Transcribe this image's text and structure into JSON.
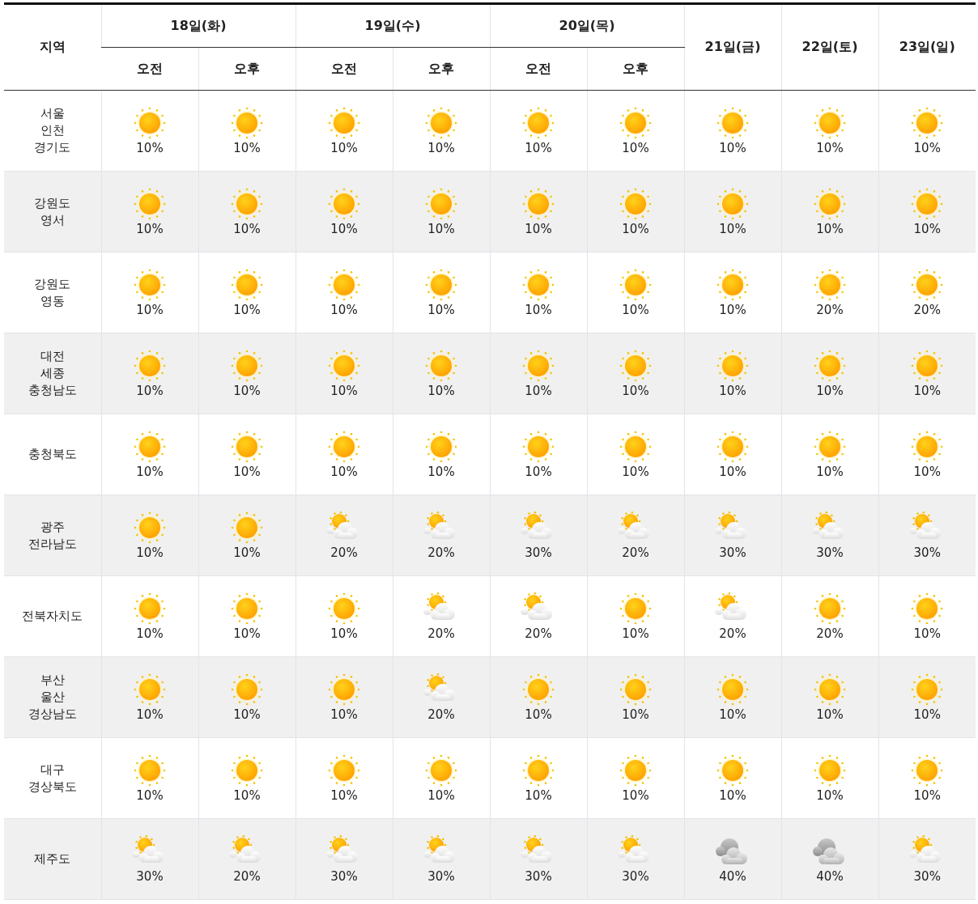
{
  "table": {
    "region_header": "지역",
    "days": [
      {
        "label": "18일(화)",
        "periods": [
          "오전",
          "오후"
        ]
      },
      {
        "label": "19일(수)",
        "periods": [
          "오전",
          "오후"
        ]
      },
      {
        "label": "20일(목)",
        "periods": [
          "오전",
          "오후"
        ]
      },
      {
        "label": "21일(금)"
      },
      {
        "label": "22일(토)"
      },
      {
        "label": "23일(일)"
      }
    ],
    "rows": [
      {
        "region": "서울\n인천\n경기도",
        "cells": [
          {
            "kind": "sunny",
            "pop": "10%"
          },
          {
            "kind": "sunny",
            "pop": "10%"
          },
          {
            "kind": "sunny",
            "pop": "10%"
          },
          {
            "kind": "sunny",
            "pop": "10%"
          },
          {
            "kind": "sunny",
            "pop": "10%"
          },
          {
            "kind": "sunny",
            "pop": "10%"
          },
          {
            "kind": "sunny",
            "pop": "10%"
          },
          {
            "kind": "sunny",
            "pop": "10%"
          },
          {
            "kind": "sunny",
            "pop": "10%"
          }
        ]
      },
      {
        "region": "강원도\n영서",
        "cells": [
          {
            "kind": "sunny",
            "pop": "10%"
          },
          {
            "kind": "sunny",
            "pop": "10%"
          },
          {
            "kind": "sunny",
            "pop": "10%"
          },
          {
            "kind": "sunny",
            "pop": "10%"
          },
          {
            "kind": "sunny",
            "pop": "10%"
          },
          {
            "kind": "sunny",
            "pop": "10%"
          },
          {
            "kind": "sunny",
            "pop": "10%"
          },
          {
            "kind": "sunny",
            "pop": "10%"
          },
          {
            "kind": "sunny",
            "pop": "10%"
          }
        ]
      },
      {
        "region": "강원도\n영동",
        "cells": [
          {
            "kind": "sunny",
            "pop": "10%"
          },
          {
            "kind": "sunny",
            "pop": "10%"
          },
          {
            "kind": "sunny",
            "pop": "10%"
          },
          {
            "kind": "sunny",
            "pop": "10%"
          },
          {
            "kind": "sunny",
            "pop": "10%"
          },
          {
            "kind": "sunny",
            "pop": "10%"
          },
          {
            "kind": "sunny",
            "pop": "10%"
          },
          {
            "kind": "sunny",
            "pop": "20%"
          },
          {
            "kind": "sunny",
            "pop": "20%"
          }
        ]
      },
      {
        "region": "대전\n세종\n충청남도",
        "cells": [
          {
            "kind": "sunny",
            "pop": "10%"
          },
          {
            "kind": "sunny",
            "pop": "10%"
          },
          {
            "kind": "sunny",
            "pop": "10%"
          },
          {
            "kind": "sunny",
            "pop": "10%"
          },
          {
            "kind": "sunny",
            "pop": "10%"
          },
          {
            "kind": "sunny",
            "pop": "10%"
          },
          {
            "kind": "sunny",
            "pop": "10%"
          },
          {
            "kind": "sunny",
            "pop": "10%"
          },
          {
            "kind": "sunny",
            "pop": "10%"
          }
        ]
      },
      {
        "region": "충청북도",
        "cells": [
          {
            "kind": "sunny",
            "pop": "10%"
          },
          {
            "kind": "sunny",
            "pop": "10%"
          },
          {
            "kind": "sunny",
            "pop": "10%"
          },
          {
            "kind": "sunny",
            "pop": "10%"
          },
          {
            "kind": "sunny",
            "pop": "10%"
          },
          {
            "kind": "sunny",
            "pop": "10%"
          },
          {
            "kind": "sunny",
            "pop": "10%"
          },
          {
            "kind": "sunny",
            "pop": "10%"
          },
          {
            "kind": "sunny",
            "pop": "10%"
          }
        ]
      },
      {
        "region": "광주\n전라남도",
        "cells": [
          {
            "kind": "sunny",
            "pop": "10%"
          },
          {
            "kind": "sunny",
            "pop": "10%"
          },
          {
            "kind": "partly_cloudy",
            "pop": "20%"
          },
          {
            "kind": "partly_cloudy",
            "pop": "20%"
          },
          {
            "kind": "partly_cloudy",
            "pop": "30%"
          },
          {
            "kind": "partly_cloudy",
            "pop": "20%"
          },
          {
            "kind": "partly_cloudy",
            "pop": "30%"
          },
          {
            "kind": "partly_cloudy",
            "pop": "30%"
          },
          {
            "kind": "partly_cloudy",
            "pop": "30%"
          }
        ]
      },
      {
        "region": "전북자치도",
        "cells": [
          {
            "kind": "sunny",
            "pop": "10%"
          },
          {
            "kind": "sunny",
            "pop": "10%"
          },
          {
            "kind": "sunny",
            "pop": "10%"
          },
          {
            "kind": "partly_cloudy",
            "pop": "20%"
          },
          {
            "kind": "partly_cloudy",
            "pop": "20%"
          },
          {
            "kind": "sunny",
            "pop": "10%"
          },
          {
            "kind": "partly_cloudy",
            "pop": "20%"
          },
          {
            "kind": "sunny",
            "pop": "20%"
          },
          {
            "kind": "sunny",
            "pop": "10%"
          }
        ]
      },
      {
        "region": "부산\n울산\n경상남도",
        "cells": [
          {
            "kind": "sunny",
            "pop": "10%"
          },
          {
            "kind": "sunny",
            "pop": "10%"
          },
          {
            "kind": "sunny",
            "pop": "10%"
          },
          {
            "kind": "partly_cloudy",
            "pop": "20%"
          },
          {
            "kind": "sunny",
            "pop": "10%"
          },
          {
            "kind": "sunny",
            "pop": "10%"
          },
          {
            "kind": "sunny",
            "pop": "10%"
          },
          {
            "kind": "sunny",
            "pop": "10%"
          },
          {
            "kind": "sunny",
            "pop": "10%"
          }
        ]
      },
      {
        "region": "대구\n경상북도",
        "cells": [
          {
            "kind": "sunny",
            "pop": "10%"
          },
          {
            "kind": "sunny",
            "pop": "10%"
          },
          {
            "kind": "sunny",
            "pop": "10%"
          },
          {
            "kind": "sunny",
            "pop": "10%"
          },
          {
            "kind": "sunny",
            "pop": "10%"
          },
          {
            "kind": "sunny",
            "pop": "10%"
          },
          {
            "kind": "sunny",
            "pop": "10%"
          },
          {
            "kind": "sunny",
            "pop": "10%"
          },
          {
            "kind": "sunny",
            "pop": "10%"
          }
        ]
      },
      {
        "region": "제주도",
        "cells": [
          {
            "kind": "partly_cloudy",
            "pop": "30%"
          },
          {
            "kind": "partly_cloudy",
            "pop": "20%"
          },
          {
            "kind": "partly_cloudy",
            "pop": "30%"
          },
          {
            "kind": "partly_cloudy",
            "pop": "30%"
          },
          {
            "kind": "partly_cloudy",
            "pop": "30%"
          },
          {
            "kind": "partly_cloudy",
            "pop": "30%"
          },
          {
            "kind": "cloudy",
            "pop": "40%"
          },
          {
            "kind": "cloudy",
            "pop": "40%"
          },
          {
            "kind": "partly_cloudy",
            "pop": "30%"
          }
        ]
      }
    ]
  }
}
